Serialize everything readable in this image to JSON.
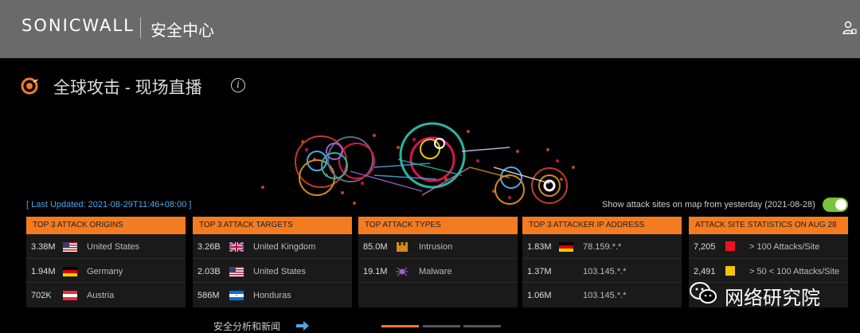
{
  "header": {
    "brand": "SONICWALL",
    "app_title": "安全中心"
  },
  "page": {
    "title": "全球攻击 - 现场直播"
  },
  "status": {
    "last_updated": "[ Last Updated: 2021-08-29T11:46+08:00 ]",
    "toggle_label": "Show attack sites on map from yesterday (2021-08-28)",
    "toggle_on": true
  },
  "panels": {
    "origins": {
      "title": "TOP 3 ATTACK ORIGINS",
      "rows": [
        {
          "value": "3.38M",
          "flag": "us-flag-icon",
          "name": "United States"
        },
        {
          "value": "1.94M",
          "flag": "de-flag-icon",
          "name": "Germany"
        },
        {
          "value": "702K",
          "flag": "at-flag-icon",
          "name": "Austria"
        }
      ]
    },
    "targets": {
      "title": "TOP 3 ATTACK TARGETS",
      "rows": [
        {
          "value": "3.26B",
          "flag": "uk-flag-icon",
          "name": "United Kingdom"
        },
        {
          "value": "2.03B",
          "flag": "us-flag-icon",
          "name": "United States"
        },
        {
          "value": "586M",
          "flag": "hn-flag-icon",
          "name": "Honduras"
        }
      ]
    },
    "types": {
      "title": "TOP ATTACK TYPES",
      "rows": [
        {
          "value": "85.0M",
          "icon": "intrusion-icon",
          "name": "Intrusion"
        },
        {
          "value": "19.1M",
          "icon": "malware-icon",
          "name": "Malware"
        }
      ]
    },
    "ips": {
      "title": "TOP 3 ATTACKER IP ADDRESS",
      "rows": [
        {
          "value": "1.83M",
          "flag": "de-flag-icon",
          "name": "78.159.*.*"
        },
        {
          "value": "1.37M",
          "name": "103.145.*.*"
        },
        {
          "value": "1.06M",
          "name": "103.145.*.*"
        }
      ]
    },
    "stats": {
      "title": "ATTACK SITE STATISTICS ON AUG 28",
      "rows": [
        {
          "value": "7,205",
          "color": "#e8141b",
          "name": "> 100 Attacks/Site"
        },
        {
          "value": "2,491",
          "color": "#f5c400",
          "name": "> 50 < 100 Attacks/Site"
        }
      ]
    }
  },
  "footer": {
    "link_label": "安全分析和新闻",
    "pager_active": 1,
    "pager_count": 3
  },
  "watermark": {
    "text": "网络研究院"
  },
  "colors": {
    "accent": "#f47b20",
    "link": "#4ea8e8",
    "toggle": "#7ac142"
  }
}
